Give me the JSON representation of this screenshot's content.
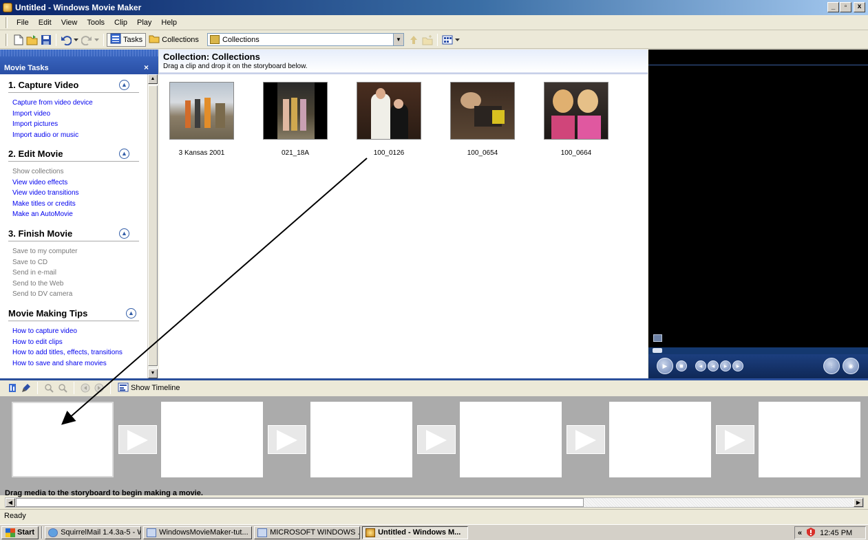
{
  "window": {
    "title": "Untitled - Windows Movie Maker",
    "controls": [
      "_",
      "▫",
      "x"
    ]
  },
  "menu": [
    "File",
    "Edit",
    "View",
    "Tools",
    "Clip",
    "Play",
    "Help"
  ],
  "toolbar": {
    "tasks_label": "Tasks",
    "collections_label": "Collections",
    "collection_select_value": "Collections"
  },
  "task_pane": {
    "header": "Movie Tasks",
    "close_label": "×",
    "sections": [
      {
        "title": "1. Capture Video",
        "links": [
          "Capture from video device",
          "Import video",
          "Import pictures",
          "Import audio or music"
        ]
      },
      {
        "title": "2. Edit Movie",
        "links": [
          "Show collections",
          "View video effects",
          "View video transitions",
          "Make titles or credits",
          "Make an AutoMovie"
        ]
      },
      {
        "title": "3. Finish Movie",
        "links": [
          "Save to my computer",
          "Save to CD",
          "Send in e-mail",
          "Send to the Web",
          "Send to DV camera"
        ]
      },
      {
        "title": "Movie Making Tips",
        "links": [
          "How to capture video",
          "How to edit clips",
          "How to add titles, effects, transitions",
          "How to save and share movies"
        ]
      }
    ]
  },
  "collection": {
    "title": "Collection: Collections",
    "subtitle": "Drag a clip and drop it on the storyboard below.",
    "clips": [
      "3 Kansas 2001",
      "021_18A",
      "100_0126",
      "100_0654",
      "100_0664"
    ]
  },
  "storyboard": {
    "show_timeline_label": "Show Timeline",
    "hint": "Drag media to the storyboard to begin making a movie."
  },
  "status": "Ready",
  "taskbar": {
    "start_label": "Start",
    "tasks": [
      "SquirrelMail 1.4.3a-5 - W...",
      "WindowsMovieMaker-tut...",
      "MICROSOFT WINDOWS ...",
      "Untitled - Windows M..."
    ],
    "clock": "12:45 PM",
    "tray_chevron": "«"
  },
  "colors": {
    "accent_blue": "#2b4f9b",
    "link_blue": "#0000ee",
    "preview_bg": "#000000",
    "storyboard_bg": "#ababab"
  }
}
